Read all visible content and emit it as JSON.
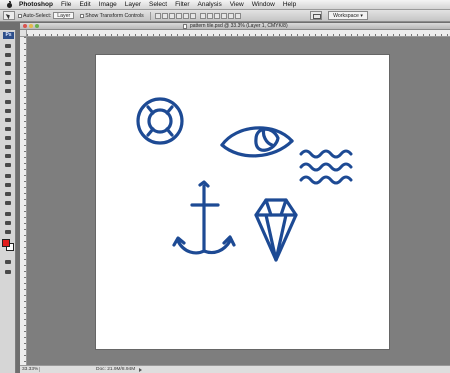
{
  "menubar": {
    "app_name": "Photoshop",
    "items": [
      "File",
      "Edit",
      "Image",
      "Layer",
      "Select",
      "Filter",
      "Analysis",
      "View",
      "Window",
      "Help"
    ]
  },
  "options": {
    "auto_select_label": "Auto-Select:",
    "auto_select_value": "Layer",
    "transform_label": "Show Transform Controls",
    "workspace_label": "Workspace ▾"
  },
  "toolbox": {
    "logo": "Ps",
    "foreground_color": "#e11c1c",
    "background_color": "#ffffff"
  },
  "document": {
    "title": "pattern tile.psd @ 33.3% (Layer 1, CMYK/8)",
    "zoom": "33.33%",
    "doc_info": "Doc: 21.9M/8.94M"
  },
  "artwork": {
    "ink_color": "#1d4a94",
    "icons": [
      "lifebuoy-icon",
      "eye-icon",
      "waves-icon",
      "anchor-icon",
      "diamond-icon"
    ]
  }
}
